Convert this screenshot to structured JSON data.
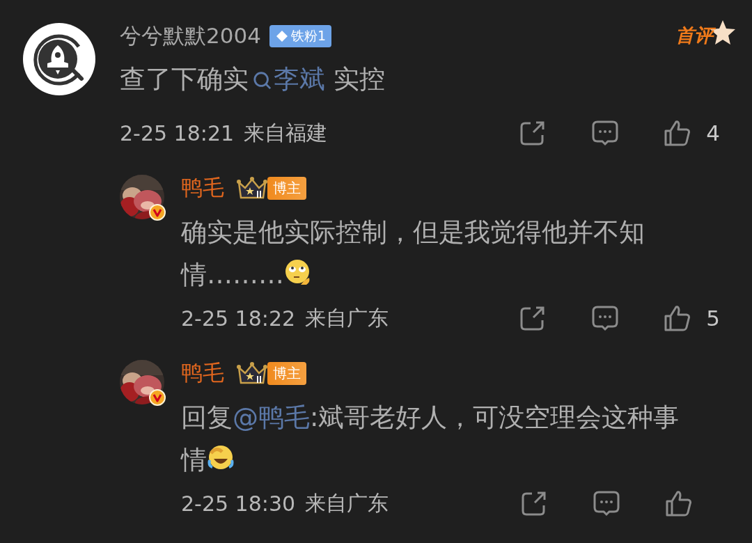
{
  "comment": {
    "username": "兮兮默默2004",
    "fan_badge": "铁粉1",
    "tag": "首评",
    "text": [
      {
        "kind": "text",
        "t": "查了下确实"
      },
      {
        "kind": "topic",
        "t": "李斌"
      },
      {
        "kind": "text",
        "t": " 实控"
      }
    ],
    "time": "2-25 18:21",
    "location": "来自福建",
    "likes": "4"
  },
  "replies": [
    {
      "username": "鸭毛",
      "role": "博主",
      "text": [
        {
          "kind": "text",
          "t": "确实是他实际控制，但是我觉得他并不知情………"
        },
        {
          "kind": "doubt"
        }
      ],
      "time": "2-25 18:22",
      "location": "来自广东",
      "likes": "5"
    },
    {
      "username": "鸭毛",
      "role": "博主",
      "text": [
        {
          "kind": "text",
          "t": "回复"
        },
        {
          "kind": "mention",
          "t": "@鸭毛"
        },
        {
          "kind": "text",
          "t": ":斌哥老好人，可没空理会这种事情"
        },
        {
          "kind": "laugh"
        }
      ],
      "time": "2-25 18:30",
      "location": "来自广东"
    }
  ]
}
